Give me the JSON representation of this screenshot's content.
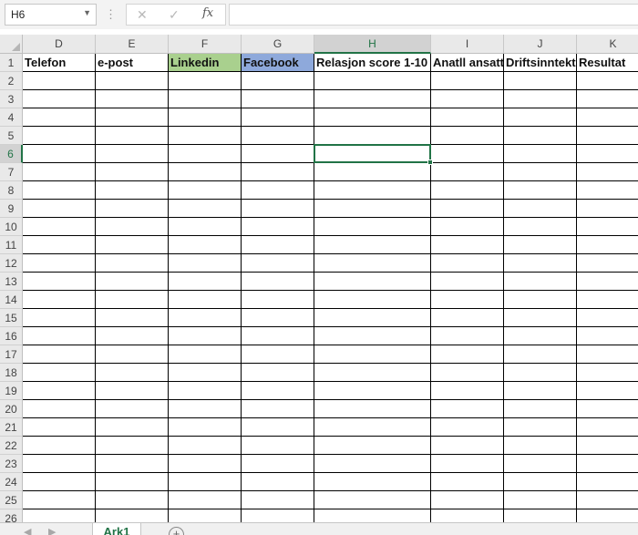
{
  "formula_bar": {
    "name_box": "H6",
    "cancel_icon": "✕",
    "enter_icon": "✓",
    "fx_label": "fx",
    "formula": ""
  },
  "columns": [
    "D",
    "E",
    "F",
    "G",
    "H",
    "I",
    "J",
    "K"
  ],
  "active_column": "H",
  "active_row": 6,
  "rows": [
    "1",
    "2",
    "3",
    "4",
    "5",
    "6",
    "7",
    "8",
    "9",
    "10",
    "11",
    "12",
    "13",
    "14",
    "15",
    "16",
    "17",
    "18",
    "19",
    "20",
    "21",
    "22",
    "23",
    "24",
    "25",
    "26"
  ],
  "header_cells": [
    {
      "col": "D",
      "text": "Telefon",
      "fill": ""
    },
    {
      "col": "E",
      "text": "e-post",
      "fill": ""
    },
    {
      "col": "F",
      "text": "Linkedin",
      "fill": "#a9d08e"
    },
    {
      "col": "G",
      "text": "Facebook",
      "fill": "#8ea9db"
    },
    {
      "col": "H",
      "text": "Relasjon score 1-10",
      "fill": ""
    },
    {
      "col": "I",
      "text": "Anatll ansatte",
      "fill": ""
    },
    {
      "col": "J",
      "text": "Driftsinntekter",
      "fill": ""
    },
    {
      "col": "K",
      "text": "Resultat",
      "fill": ""
    }
  ],
  "sheet_tabs": [
    {
      "label": "Ark1",
      "active": true
    }
  ],
  "icons": {
    "dropdown": "chevron-down-icon",
    "add_sheet": "plus-circle-icon",
    "prev": "triangle-left-icon",
    "next": "triangle-right-icon"
  },
  "colors": {
    "accent": "#217346",
    "linkedin_fill": "#a9d08e",
    "facebook_fill": "#8ea9db"
  }
}
